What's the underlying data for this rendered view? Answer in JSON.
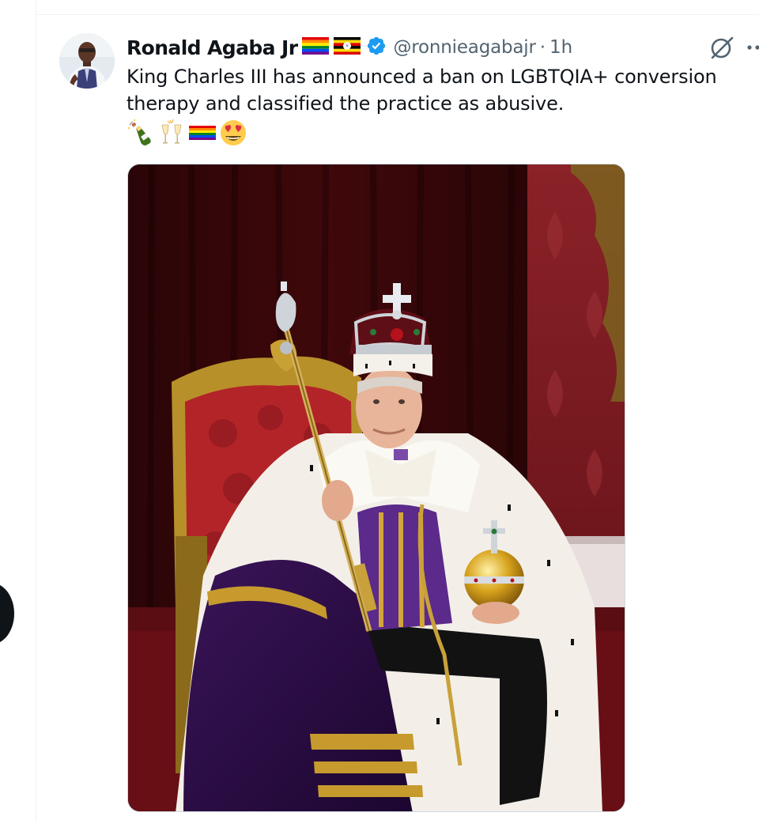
{
  "tweet": {
    "author": {
      "display_name": "Ronald Agaba Jr",
      "handle": "@ronnieagabajr",
      "verified": true,
      "flags": [
        "rainbow-flag-icon",
        "uganda-flag-icon"
      ]
    },
    "separator": "·",
    "timestamp": "1h",
    "text_lines": [
      "King Charles III has announced a ban on LGBTQIA+ conversion",
      "therapy and classified the practice as abusive."
    ],
    "emojis": [
      "bottle-with-popping-cork-icon",
      "clinking-glasses-icon",
      "rainbow-flag-icon",
      "heart-eyes-face-icon"
    ],
    "media": {
      "type": "photo",
      "icons": [
        "throne-icon",
        "crown-icon",
        "sceptre-icon",
        "orb-icon"
      ]
    }
  },
  "header_actions": [
    "grok-icon",
    "more-icon"
  ],
  "colors": {
    "text_primary": "#0f1419",
    "text_secondary": "#536471",
    "verified_blue": "#1d9bf0",
    "divider": "#eff3f4"
  }
}
